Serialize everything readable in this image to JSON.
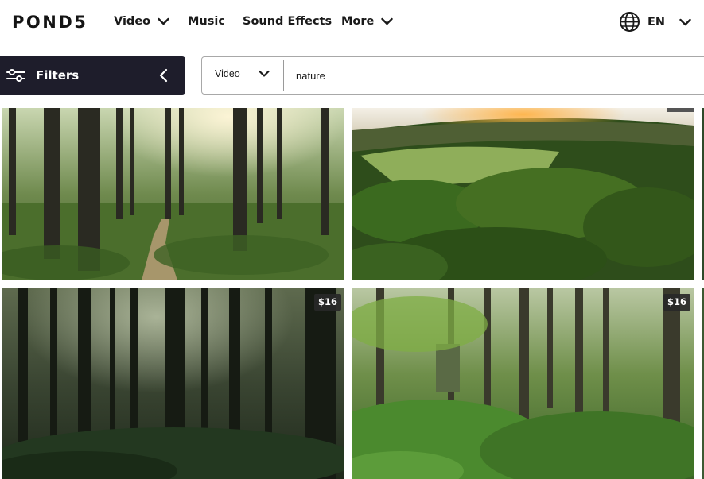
{
  "brand": {
    "logo": "POND5"
  },
  "nav": {
    "video": "Video",
    "music": "Music",
    "sound_effects": "Sound Effects",
    "more": "More",
    "language": "EN"
  },
  "filters": {
    "label": "Filters"
  },
  "search": {
    "media_type": "Video",
    "query": "nature"
  },
  "results": [
    {
      "price": ""
    },
    {
      "price": ""
    },
    {
      "price": "$16"
    },
    {
      "price": "$16"
    }
  ],
  "colors": {
    "filters_bg": "#1e1d2b",
    "price_badge_bg": "#282828",
    "text": "#1a1a1a"
  },
  "icons": [
    "chevron-down-icon",
    "globe-icon",
    "sliders-icon",
    "chevron-left-icon"
  ]
}
